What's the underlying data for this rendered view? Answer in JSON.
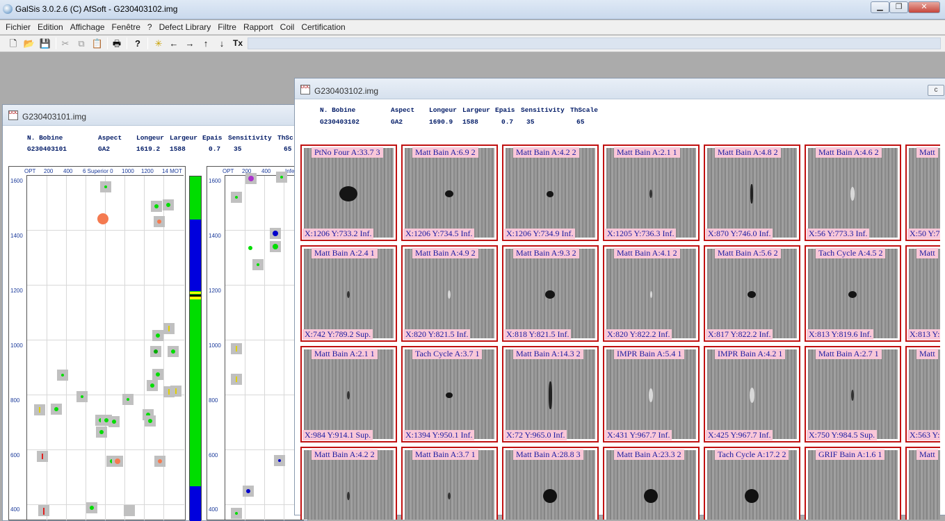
{
  "app": {
    "title": "GalSis 3.0.2.6  (C) AfSoft  - G230403102.img",
    "window_buttons": [
      "▁",
      "❐",
      "✕"
    ]
  },
  "menu": [
    "Fichier",
    "Edition",
    "Affichage",
    "Fenêtre",
    "?",
    "Defect Library",
    "Filtre",
    "Rapport",
    "Coil",
    "Certification"
  ],
  "toolbar": {
    "icons": [
      "new-file-icon",
      "open-folder-icon",
      "save-icon",
      "cut-icon",
      "copy-icon",
      "paste-icon",
      "print-icon",
      "help-icon",
      "sparkle-icon",
      "arrow-left-icon",
      "arrow-right-icon",
      "arrow-up-icon",
      "arrow-down-icon",
      "tx-icon"
    ],
    "tx_label": "Tx"
  },
  "win1": {
    "title": "G230403101.img",
    "headers": [
      "N. Bobine",
      "Aspect",
      "Longeur",
      "Largeur",
      "Epais",
      "Sensitivity",
      "ThSc"
    ],
    "values": [
      "G230403101",
      "GA2",
      "1619.2",
      "1588",
      "0.7",
      "35",
      "65"
    ],
    "plot1": {
      "xticks": [
        "OPT",
        "200",
        "400",
        "6 Superior 0",
        "1000",
        "1200",
        "14 MOT"
      ],
      "yticks": [
        "1600",
        "1400",
        "1200",
        "1000",
        "800",
        "600",
        "400"
      ]
    },
    "plot2": {
      "xticks": [
        "OPT",
        "200",
        "400",
        "Infe"
      ],
      "yticks": [
        "1600",
        "1400",
        "1200",
        "1000",
        "800",
        "600",
        "400"
      ]
    }
  },
  "win2": {
    "title": "G230403102.img",
    "headers": [
      "N. Bobine",
      "Aspect",
      "Longeur",
      "Largeur",
      "Epais",
      "Sensitivity",
      "ThScale"
    ],
    "values": [
      "G230403102",
      "GA2",
      "1690.9",
      "1588",
      "0.7",
      "35",
      "65"
    ],
    "tiles": [
      [
        {
          "top": "PtNo Four A:33.7   3",
          "bot": "X:1206 Y:733.2   Inf."
        },
        {
          "top": "Matt Bain A:6.9   2",
          "bot": "X:1206 Y:734.5   Inf."
        },
        {
          "top": "Matt Bain A:4.2   2",
          "bot": "X:1206 Y:734.9   Inf."
        },
        {
          "top": "Matt Bain A:2.1   1",
          "bot": "X:1205 Y:736.3   Inf."
        },
        {
          "top": "Matt Bain A:4.8   2",
          "bot": "X:870 Y:746.0   Inf."
        },
        {
          "top": "Matt Bain A:4.6   2",
          "bot": "X:56 Y:773.3   Inf."
        },
        {
          "top": "Matt",
          "bot": "X:50 Y:7"
        }
      ],
      [
        {
          "top": "Matt Bain A:2.4   1",
          "bot": "X:742 Y:789.2   Sup."
        },
        {
          "top": "Matt Bain A:4.9   2",
          "bot": "X:820 Y:821.5   Inf."
        },
        {
          "top": "Matt Bain A:9.3   2",
          "bot": "X:818 Y:821.5   Inf."
        },
        {
          "top": "Matt Bain A:4.1   2",
          "bot": "X:820 Y:822.2   Inf."
        },
        {
          "top": "Matt Bain A:5.6   2",
          "bot": "X:817 Y:822.2   Inf."
        },
        {
          "top": "Tach Cycle A:4.5   2",
          "bot": "X:813 Y:819.6   Inf."
        },
        {
          "top": "Matt",
          "bot": "X:813 Y:"
        }
      ],
      [
        {
          "top": "Matt Bain A:2.1   1",
          "bot": "X:984 Y:914.1   Sup."
        },
        {
          "top": "Tach Cycle A:3.7   1",
          "bot": "X:1394 Y:950.1   Inf."
        },
        {
          "top": "Matt Bain A:14.3   2",
          "bot": "X:72 Y:965.0   Inf."
        },
        {
          "top": "IMPR Bain A:5.4   1",
          "bot": "X:431 Y:967.7   Inf."
        },
        {
          "top": "IMPR Bain A:4.2   1",
          "bot": "X:425 Y:967.7   Inf."
        },
        {
          "top": "Matt Bain A:2.7   1",
          "bot": "X:750 Y:984.5   Sup."
        },
        {
          "top": "Matt",
          "bot": "X:563 Y:"
        }
      ],
      [
        {
          "top": "Matt Bain A:4.2   2",
          "bot": ""
        },
        {
          "top": "Matt Bain A:3.7   1",
          "bot": ""
        },
        {
          "top": "Matt Bain A:28.8   3",
          "bot": ""
        },
        {
          "top": "Matt Bain A:23.3   2",
          "bot": ""
        },
        {
          "top": "Tach Cycle A:17.2   2",
          "bot": ""
        },
        {
          "top": "GRIF Bain A:1.6   1",
          "bot": ""
        },
        {
          "top": "Matt",
          "bot": ""
        }
      ]
    ]
  },
  "colors": {
    "tile_border": "#c01010",
    "label_bg": "#f9c7d8",
    "label_text": "#1a1aa0",
    "status_green": "#00dd00",
    "status_blue": "#0000dd"
  }
}
